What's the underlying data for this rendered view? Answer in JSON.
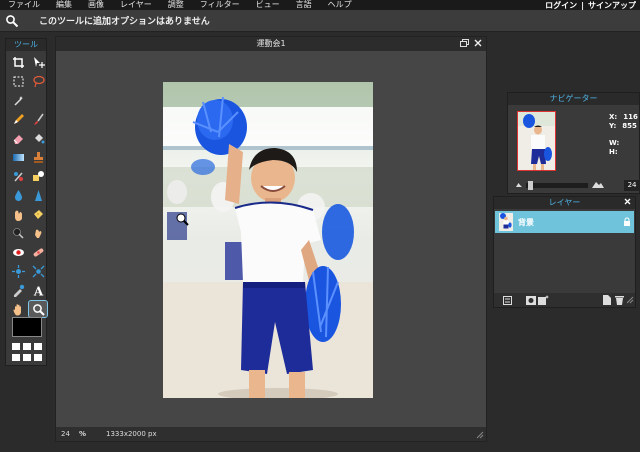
{
  "menu": {
    "items": [
      "ファイル",
      "編集",
      "画像",
      "レイヤー",
      "調整",
      "フィルター",
      "ビュー",
      "言語",
      "ヘルプ"
    ],
    "login": "ログイン",
    "separator": "|",
    "signup": "サインアップ"
  },
  "options": {
    "message": "このツールに追加オプションはありません",
    "tool_icon": "magnifier-icon"
  },
  "tools": {
    "title": "ツール",
    "foreground_color": "#000000"
  },
  "document": {
    "title": "運動会1",
    "zoom": "24",
    "zoom_unit": "%",
    "size": "1333x2000 px"
  },
  "navigator": {
    "title": "ナビゲーター",
    "x_label": "X:",
    "x_value": "116",
    "y_label": "Y:",
    "y_value": "855",
    "w_label": "W:",
    "h_label": "H:",
    "zoom": "24"
  },
  "layers": {
    "title": "レイヤー",
    "items": [
      {
        "name": "背景"
      }
    ]
  },
  "colors": {
    "accent": "#4fb4e6",
    "layer_selected": "#6fc4dc"
  }
}
